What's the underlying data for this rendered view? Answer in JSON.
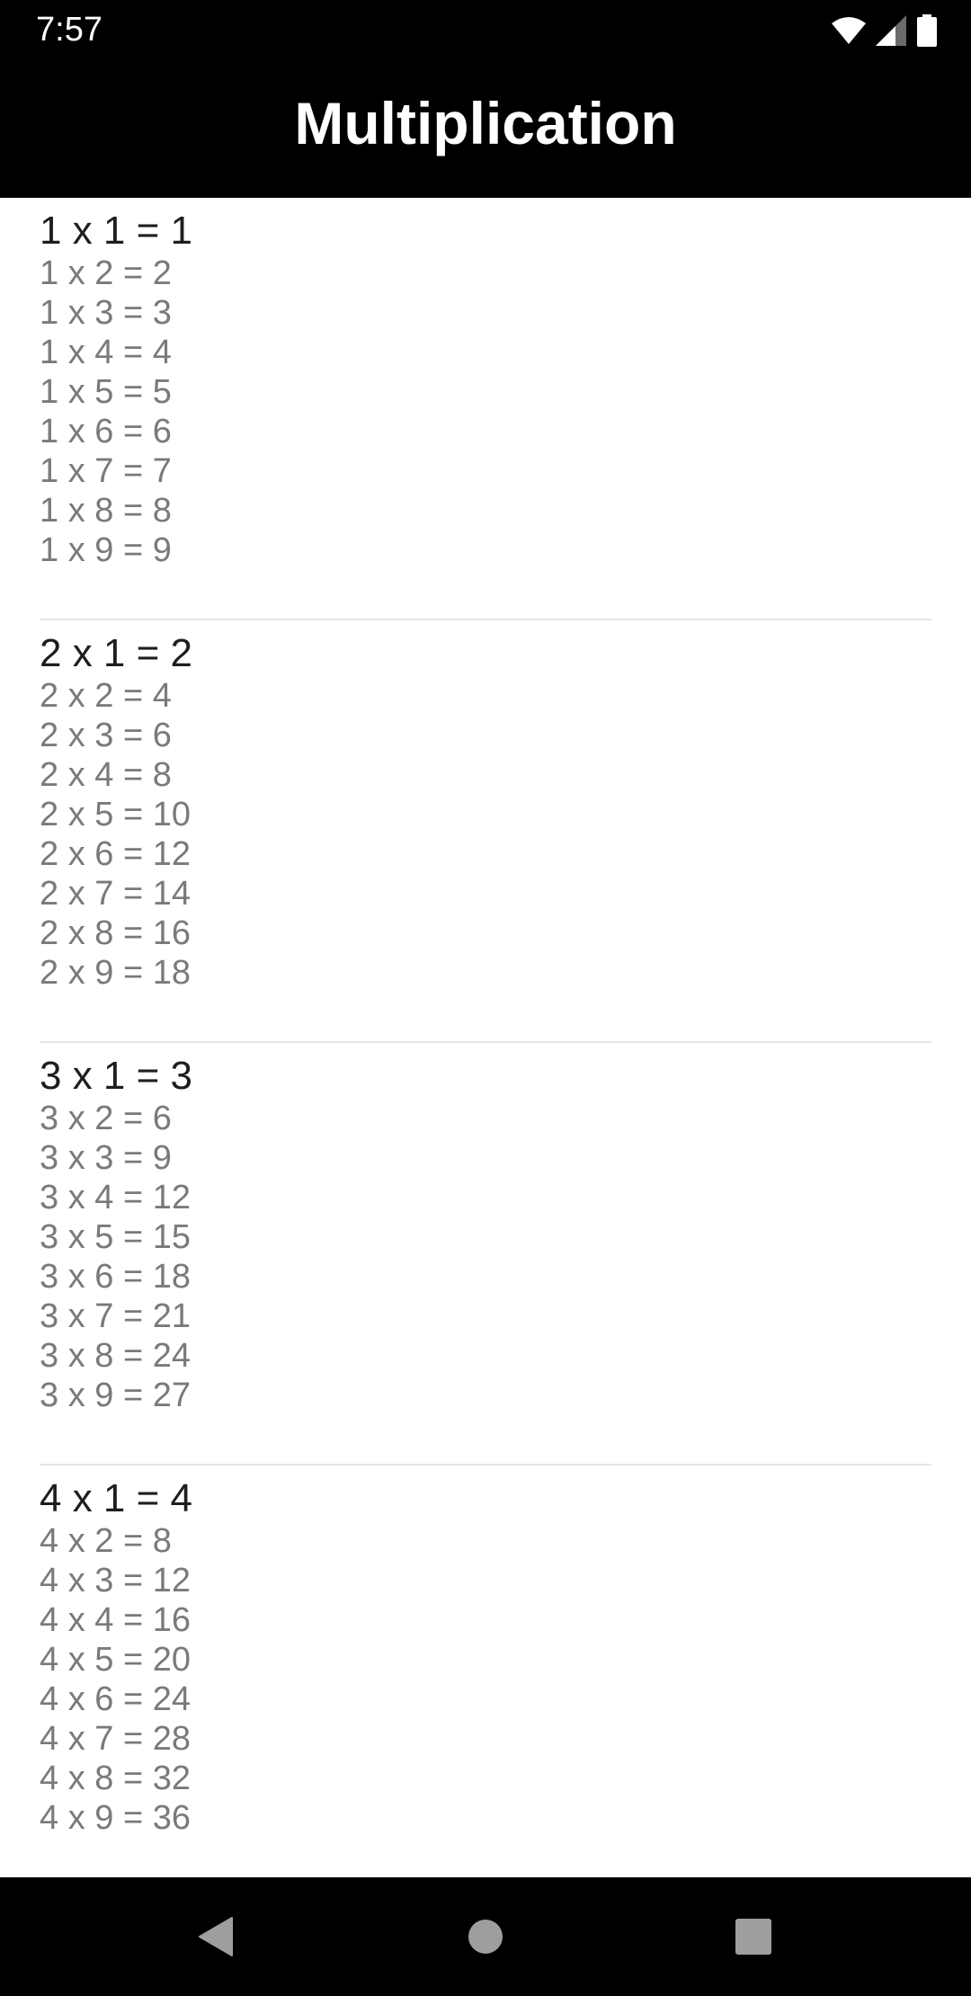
{
  "status_bar": {
    "time": "7:57"
  },
  "app_bar": {
    "title": "Multiplication"
  },
  "tables": [
    {
      "first": "1 x 1 = 1",
      "rows": [
        "1 x 2 = 2",
        "1 x 3 = 3",
        "1 x 4 = 4",
        "1 x 5 = 5",
        "1 x 6 = 6",
        "1 x 7 = 7",
        "1 x 8 = 8",
        "1 x 9 = 9"
      ]
    },
    {
      "first": "2 x 1 = 2",
      "rows": [
        "2 x 2 = 4",
        "2 x 3 = 6",
        "2 x 4 = 8",
        "2 x 5 = 10",
        "2 x 6 = 12",
        "2 x 7 = 14",
        "2 x 8 = 16",
        "2 x 9 = 18"
      ]
    },
    {
      "first": "3 x 1 = 3",
      "rows": [
        "3 x 2 = 6",
        "3 x 3 = 9",
        "3 x 4 = 12",
        "3 x 5 = 15",
        "3 x 6 = 18",
        "3 x 7 = 21",
        "3 x 8 = 24",
        "3 x 9 = 27"
      ]
    },
    {
      "first": "4 x 1 = 4",
      "rows": [
        "4 x 2 = 8",
        "4 x 3 = 12",
        "4 x 4 = 16",
        "4 x 5 = 20",
        "4 x 6 = 24",
        "4 x 7 = 28",
        "4 x 8 = 32",
        "4 x 9 = 36"
      ]
    }
  ],
  "nav_bar": {
    "back_icon": "back-triangle-icon",
    "home_icon": "home-circle-icon",
    "recents_icon": "recents-square-icon"
  },
  "colors": {
    "bar_background": "#000000",
    "first_row_text": "#1e1e1e",
    "row_text": "#7a7a7a",
    "divider": "#e6e6e6",
    "nav_icon": "#9e9e9e"
  }
}
